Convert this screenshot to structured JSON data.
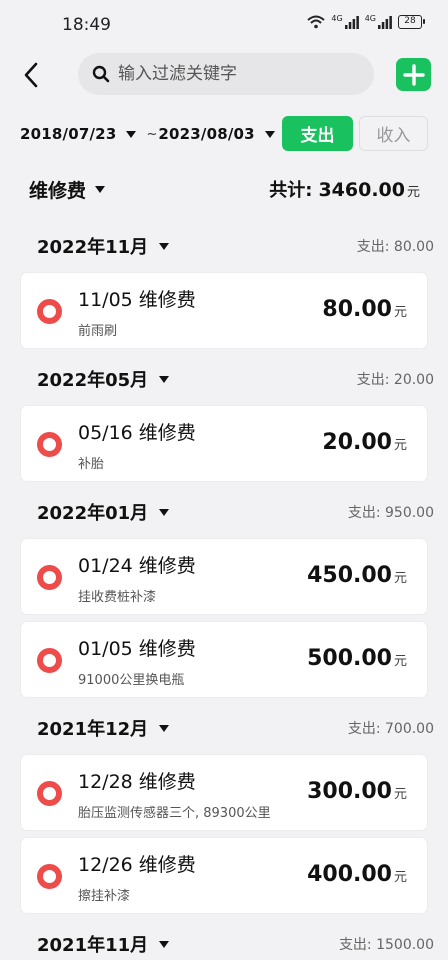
{
  "status_bar": {
    "time": "18:49",
    "net1": "4G",
    "net2": "4G",
    "battery": "28"
  },
  "header": {
    "search_placeholder": "输入过滤关键字",
    "icons": [
      "back-arrow-icon",
      "search-icon",
      "plus-icon"
    ],
    "accent_color": "#19c15f"
  },
  "filters": {
    "start_date": "2018/07/23",
    "tilde": "~",
    "end_date": "2023/08/03",
    "expense_label": "支出",
    "income_label": "收入",
    "selected": "expense"
  },
  "summary": {
    "category": "维修费",
    "total_label": "共计:",
    "total_value": "3460.00",
    "unit": "元"
  },
  "groups": [
    {
      "month": "2022年11月",
      "total": "支出: 80.00",
      "items": [
        {
          "title": "11/05  维修费",
          "note": "前雨刷",
          "amount": "80.00",
          "unit": "元"
        }
      ]
    },
    {
      "month": "2022年05月",
      "total": "支出: 20.00",
      "items": [
        {
          "title": "05/16  维修费",
          "note": "补胎",
          "amount": "20.00",
          "unit": "元"
        }
      ]
    },
    {
      "month": "2022年01月",
      "total": "支出: 950.00",
      "items": [
        {
          "title": "01/24  维修费",
          "note": "挂收费桩补漆",
          "amount": "450.00",
          "unit": "元"
        },
        {
          "title": "01/05  维修费",
          "note": "91000公里换电瓶",
          "amount": "500.00",
          "unit": "元"
        }
      ]
    },
    {
      "month": "2021年12月",
      "total": "支出: 700.00",
      "items": [
        {
          "title": "12/28  维修费",
          "note": "胎压监测传感器三个, 89300公里",
          "amount": "300.00",
          "unit": "元"
        },
        {
          "title": "12/26  维修费",
          "note": "擦挂补漆",
          "amount": "400.00",
          "unit": "元"
        }
      ]
    },
    {
      "month": "2021年11月",
      "total": "支出: 1500.00",
      "items": []
    }
  ]
}
